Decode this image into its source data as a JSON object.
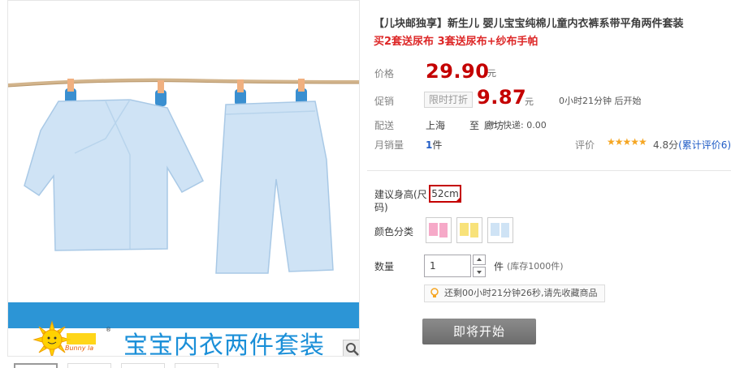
{
  "product": {
    "title": "【儿块邮独享】新生儿 婴儿宝宝纯棉儿童内衣裤系带平角两件套装",
    "subtitle": "买2套送尿布 3套送尿布+纱布手帕",
    "banner_text": "宝宝内衣两件套装",
    "brand_en": "Bunny la",
    "brand_reg": "®",
    "zoom_icon": "magnifier-icon"
  },
  "price": {
    "label": "价格",
    "value": "29.90",
    "unit": "元"
  },
  "promo": {
    "label": "促销",
    "tag": "限时打折",
    "value": "9.87",
    "unit": "元",
    "countdown": "0小时21分钟 后开始"
  },
  "shipping": {
    "label": "配送",
    "from": "上海",
    "to": "至",
    "city": "廊坊",
    "fee": "快递: 0.00"
  },
  "sales": {
    "label": "月销量",
    "count": "1",
    "unit": "件",
    "rating_label": "评价",
    "stars": "★★★★★",
    "score": "4.8分",
    "reviews": "(累计评价6)"
  },
  "size": {
    "label": "建议身高(尺码)",
    "selected": "52cm"
  },
  "color": {
    "label": "颜色分类",
    "swatches": [
      "pink",
      "yellow",
      "blue"
    ]
  },
  "quantity": {
    "label": "数量",
    "value": "1",
    "unit": "件",
    "stock": "(库存1000件)"
  },
  "tip": {
    "text": "还剩00小时21分钟26秒,请先收藏商品"
  },
  "buy_button": {
    "label": "即将开始"
  },
  "colors": {
    "price_red": "#c40000",
    "link_blue": "#205cc6",
    "banner_blue": "#2c95d6",
    "button_gray": "#7a7a7a"
  }
}
